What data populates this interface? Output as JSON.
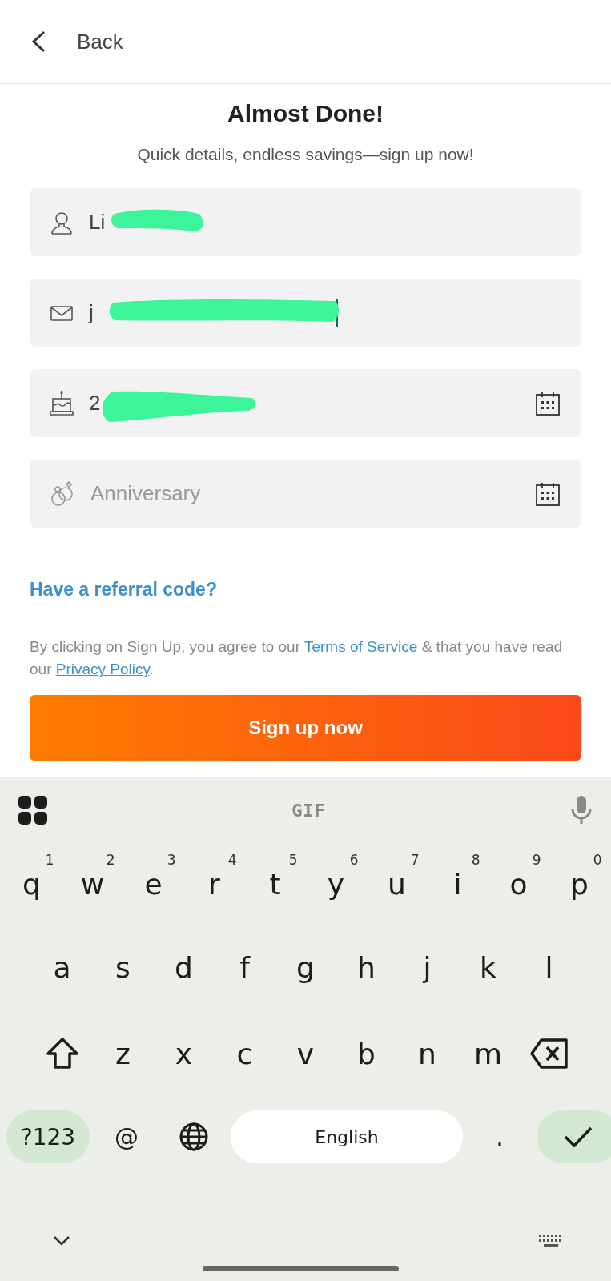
{
  "header": {
    "back_label": "Back"
  },
  "title": "Almost Done!",
  "subtitle": "Quick details, endless savings—sign up now!",
  "fields": [
    {
      "kind": "name",
      "value": "Li",
      "redacted": true,
      "focused": false,
      "calendar": false
    },
    {
      "kind": "email",
      "value": "j",
      "redacted": true,
      "focused": true,
      "calendar": false
    },
    {
      "kind": "birthday",
      "value": "2",
      "redacted": true,
      "focused": false,
      "calendar": true
    },
    {
      "kind": "anniversary",
      "placeholder": "Anniversary",
      "redacted": false,
      "focused": false,
      "calendar": true
    }
  ],
  "referral_link": "Have a referral code?",
  "terms": {
    "before": "By clicking on Sign Up, you agree to our ",
    "terms_link": "Terms of Service",
    "middle": " & that you have read our ",
    "privacy_link": "Privacy Policy",
    "after": "."
  },
  "submit_button": "Sign up now",
  "keyboard": {
    "toolbar_label": "GIF",
    "rows": [
      [
        {
          "label": "q",
          "hint": "1"
        },
        {
          "label": "w",
          "hint": "2"
        },
        {
          "label": "e",
          "hint": "3"
        },
        {
          "label": "r",
          "hint": "4"
        },
        {
          "label": "t",
          "hint": "5"
        },
        {
          "label": "y",
          "hint": "6"
        },
        {
          "label": "u",
          "hint": "7"
        },
        {
          "label": "i",
          "hint": "8"
        },
        {
          "label": "o",
          "hint": "9"
        },
        {
          "label": "p",
          "hint": "0"
        }
      ],
      [
        {
          "label": "a"
        },
        {
          "label": "s"
        },
        {
          "label": "d"
        },
        {
          "label": "f"
        },
        {
          "label": "g"
        },
        {
          "label": "h"
        },
        {
          "label": "j"
        },
        {
          "label": "k"
        },
        {
          "label": "l"
        }
      ],
      [
        {
          "kind": "shift"
        },
        {
          "label": "z"
        },
        {
          "label": "x"
        },
        {
          "label": "c"
        },
        {
          "label": "v"
        },
        {
          "label": "b"
        },
        {
          "label": "n"
        },
        {
          "label": "m"
        },
        {
          "kind": "backspace"
        }
      ]
    ],
    "bottom_row": [
      {
        "kind": "symbols",
        "label": "?123"
      },
      {
        "kind": "key",
        "label": "@"
      },
      {
        "kind": "globe"
      },
      {
        "kind": "space",
        "label": "English"
      },
      {
        "kind": "key",
        "label": "."
      },
      {
        "kind": "enter"
      }
    ]
  }
}
